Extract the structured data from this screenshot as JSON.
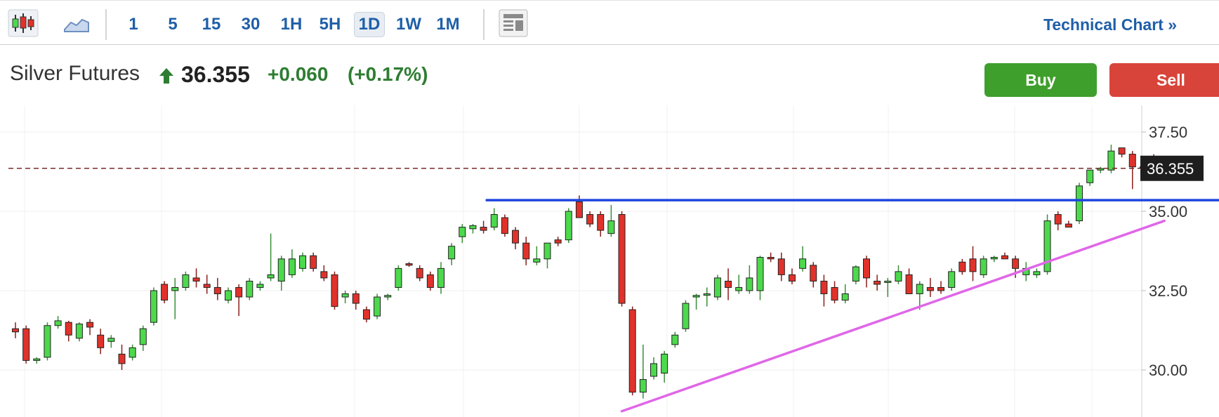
{
  "toolbar": {
    "timeframes": [
      "1",
      "5",
      "15",
      "30",
      "1H",
      "5H",
      "1D",
      "1W",
      "1M"
    ],
    "active_timeframe": "1D",
    "technical_chart_label": "Technical Chart »",
    "icons": [
      "candlestick-chart-icon",
      "area-chart-icon",
      "layout-icon"
    ]
  },
  "instrument": {
    "name": "Silver Futures",
    "price": "36.355",
    "change": "+0.060",
    "change_pct": "(+0.17%)",
    "direction_icon": "up-arrow-icon"
  },
  "actions": {
    "buy_label": "Buy",
    "sell_label": "Sell"
  },
  "colors": {
    "up": "#4cd94c",
    "down": "#e0322b",
    "support_line": "#e066e8",
    "resistance_line": "#1f44e0",
    "positive_text": "#2e7d32",
    "buy": "#3f9f2c",
    "sell": "#d9443a"
  },
  "chart_data": {
    "type": "candlestick",
    "title": "",
    "xlabel": "",
    "ylabel": "",
    "ylim": [
      28.4,
      38.0
    ],
    "y_ticks": [
      "37.50",
      "35.00",
      "32.50",
      "30.00"
    ],
    "y_tick_values": [
      37.5,
      35.0,
      32.5,
      30.0
    ],
    "last_price_label": "36.355",
    "last_price": 36.355,
    "grid": true,
    "candles": [
      [
        31.3,
        31.5,
        31.0,
        31.2
      ],
      [
        31.3,
        31.4,
        30.2,
        30.3
      ],
      [
        30.3,
        30.4,
        30.2,
        30.35
      ],
      [
        30.4,
        31.5,
        30.3,
        31.4
      ],
      [
        31.4,
        31.7,
        31.3,
        31.55
      ],
      [
        31.5,
        31.55,
        30.9,
        31.1
      ],
      [
        31.0,
        31.5,
        30.9,
        31.45
      ],
      [
        31.5,
        31.6,
        31.1,
        31.35
      ],
      [
        31.1,
        31.3,
        30.5,
        30.7
      ],
      [
        30.9,
        31.1,
        30.7,
        31.0
      ],
      [
        30.5,
        30.8,
        30.0,
        30.2
      ],
      [
        30.4,
        30.8,
        30.3,
        30.7
      ],
      [
        30.8,
        31.4,
        30.6,
        31.3
      ],
      [
        31.5,
        32.6,
        31.4,
        32.5
      ],
      [
        32.7,
        32.8,
        32.1,
        32.2
      ],
      [
        32.5,
        32.9,
        31.6,
        32.6
      ],
      [
        32.6,
        33.1,
        32.5,
        33.0
      ],
      [
        32.9,
        33.2,
        32.6,
        32.8
      ],
      [
        32.7,
        33.0,
        32.4,
        32.6
      ],
      [
        32.6,
        32.9,
        32.2,
        32.4
      ],
      [
        32.2,
        32.6,
        32.1,
        32.5
      ],
      [
        32.6,
        32.7,
        31.7,
        32.3
      ],
      [
        32.3,
        32.9,
        32.2,
        32.8
      ],
      [
        32.6,
        32.8,
        32.5,
        32.7
      ],
      [
        32.9,
        34.3,
        32.8,
        33.0
      ],
      [
        32.8,
        33.6,
        32.5,
        33.5
      ],
      [
        33.0,
        33.8,
        32.9,
        33.5
      ],
      [
        33.2,
        33.7,
        33.1,
        33.6
      ],
      [
        33.6,
        33.7,
        33.1,
        33.2
      ],
      [
        33.1,
        33.3,
        32.8,
        32.9
      ],
      [
        33.0,
        33.1,
        31.9,
        32.0
      ],
      [
        32.3,
        32.5,
        32.1,
        32.4
      ],
      [
        32.4,
        32.5,
        31.9,
        32.1
      ],
      [
        31.9,
        32.0,
        31.5,
        31.6
      ],
      [
        31.7,
        32.4,
        31.6,
        32.3
      ],
      [
        32.3,
        32.4,
        32.2,
        32.35
      ],
      [
        32.6,
        33.3,
        32.5,
        33.2
      ],
      [
        33.35,
        33.4,
        33.25,
        33.3
      ],
      [
        33.2,
        33.3,
        32.8,
        32.9
      ],
      [
        33.0,
        33.1,
        32.5,
        32.6
      ],
      [
        32.6,
        33.4,
        32.4,
        33.2
      ],
      [
        33.5,
        34.0,
        33.3,
        33.9
      ],
      [
        34.2,
        34.6,
        34.0,
        34.5
      ],
      [
        34.45,
        34.6,
        34.3,
        34.55
      ],
      [
        34.5,
        34.7,
        34.3,
        34.4
      ],
      [
        34.5,
        35.1,
        34.4,
        34.9
      ],
      [
        34.8,
        34.9,
        34.2,
        34.3
      ],
      [
        34.4,
        34.5,
        33.8,
        34.0
      ],
      [
        34.0,
        34.2,
        33.3,
        33.5
      ],
      [
        33.4,
        33.9,
        33.3,
        33.5
      ],
      [
        33.5,
        34.0,
        33.2,
        34.0
      ],
      [
        34.1,
        34.2,
        33.9,
        34.0
      ],
      [
        34.1,
        35.1,
        34.0,
        35.0
      ],
      [
        35.3,
        35.5,
        34.8,
        34.8
      ],
      [
        34.9,
        35.0,
        34.5,
        34.6
      ],
      [
        34.9,
        35.0,
        34.2,
        34.4
      ],
      [
        34.3,
        35.2,
        34.2,
        34.7
      ],
      [
        34.9,
        35.0,
        32.0,
        32.1
      ],
      [
        31.9,
        32.0,
        29.2,
        29.3
      ],
      [
        29.3,
        30.8,
        29.1,
        29.7
      ],
      [
        29.8,
        30.4,
        29.7,
        30.2
      ],
      [
        29.9,
        30.6,
        29.6,
        30.5
      ],
      [
        30.8,
        31.2,
        30.7,
        31.1
      ],
      [
        31.3,
        32.2,
        31.2,
        32.1
      ],
      [
        32.3,
        32.4,
        31.9,
        32.35
      ],
      [
        32.4,
        32.6,
        32.0,
        32.4
      ],
      [
        32.3,
        33.0,
        32.2,
        32.9
      ],
      [
        32.8,
        33.2,
        32.2,
        32.6
      ],
      [
        32.5,
        33.0,
        32.4,
        32.6
      ],
      [
        32.5,
        33.3,
        32.4,
        32.9
      ],
      [
        32.5,
        33.6,
        32.2,
        33.55
      ],
      [
        33.55,
        33.7,
        33.4,
        33.5
      ],
      [
        33.5,
        33.7,
        32.8,
        33.0
      ],
      [
        33.0,
        33.2,
        32.7,
        32.8
      ],
      [
        33.2,
        33.9,
        33.1,
        33.5
      ],
      [
        33.3,
        33.4,
        32.6,
        32.8
      ],
      [
        32.8,
        33.0,
        32.0,
        32.4
      ],
      [
        32.6,
        32.8,
        32.1,
        32.2
      ],
      [
        32.2,
        32.7,
        32.1,
        32.4
      ],
      [
        32.8,
        33.3,
        32.7,
        33.25
      ],
      [
        33.5,
        33.6,
        32.6,
        32.9
      ],
      [
        32.8,
        33.0,
        32.5,
        32.7
      ],
      [
        32.8,
        32.9,
        32.3,
        32.8
      ],
      [
        32.8,
        33.3,
        32.7,
        33.1
      ],
      [
        33.0,
        33.2,
        32.4,
        32.4
      ],
      [
        32.4,
        32.8,
        31.9,
        32.7
      ],
      [
        32.6,
        32.9,
        32.3,
        32.5
      ],
      [
        32.6,
        32.8,
        32.4,
        32.5
      ],
      [
        32.6,
        33.2,
        32.5,
        33.1
      ],
      [
        33.4,
        33.5,
        33.0,
        33.1
      ],
      [
        33.5,
        33.9,
        32.8,
        33.1
      ],
      [
        33.0,
        33.6,
        32.9,
        33.5
      ],
      [
        33.5,
        33.6,
        33.4,
        33.55
      ],
      [
        33.6,
        33.7,
        33.5,
        33.5
      ],
      [
        33.5,
        33.6,
        32.9,
        33.2
      ],
      [
        33.0,
        33.4,
        32.8,
        33.2
      ],
      [
        33.0,
        33.2,
        32.9,
        33.1
      ],
      [
        33.1,
        34.9,
        33.0,
        34.7
      ],
      [
        34.9,
        35.0,
        34.4,
        34.6
      ],
      [
        34.6,
        34.7,
        34.5,
        34.5
      ],
      [
        34.7,
        35.9,
        34.6,
        35.8
      ],
      [
        35.9,
        36.3,
        35.8,
        36.3
      ],
      [
        36.3,
        36.4,
        36.2,
        36.35
      ],
      [
        36.3,
        37.1,
        36.2,
        36.9
      ],
      [
        37.0,
        37.0,
        36.7,
        36.8
      ],
      [
        36.8,
        36.9,
        35.7,
        36.4
      ],
      [
        36.4,
        36.5,
        36.35,
        36.4
      ],
      [
        36.5,
        36.8,
        36.2,
        36.35
      ]
    ],
    "trendlines": [
      {
        "color": "#e066e8",
        "from": [
          57,
          28.7
        ],
        "to": [
          108,
          34.7
        ]
      },
      {
        "color": "#1f44e0",
        "from": [
          44.3,
          35.35
        ],
        "to": [
          115,
          35.35
        ]
      }
    ]
  }
}
